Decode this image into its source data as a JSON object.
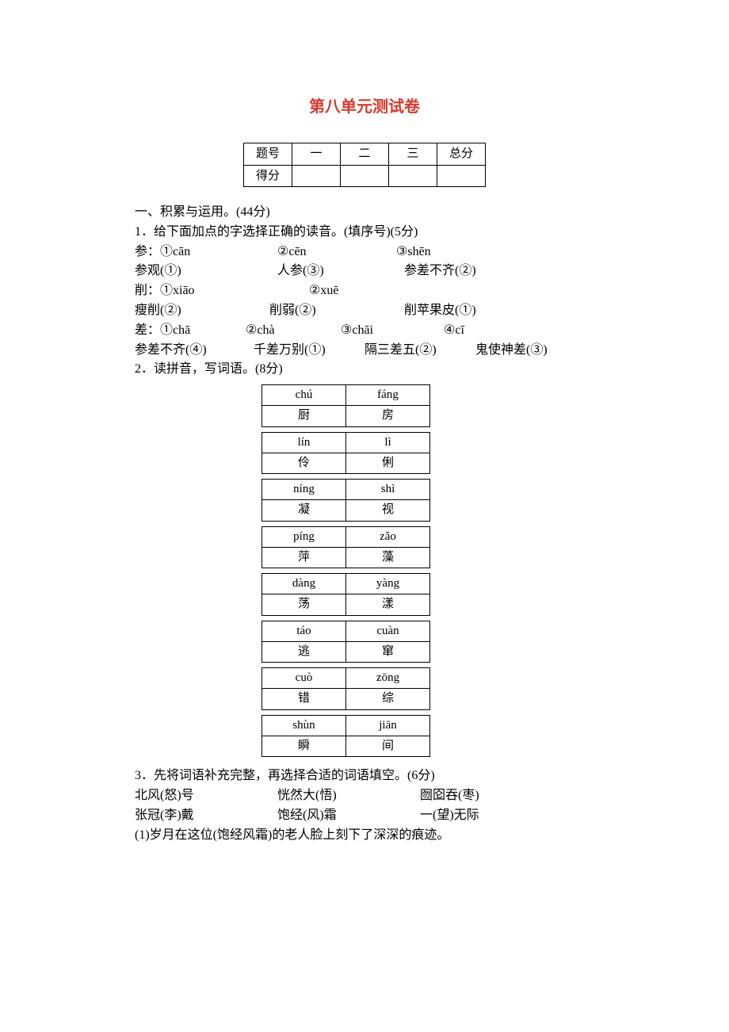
{
  "title": "第八单元测试卷",
  "scoreTable": {
    "headers": [
      "题号",
      "一",
      "二",
      "三",
      "总分"
    ],
    "row2label": "得分"
  },
  "section1": {
    "heading": "一、积累与运用。(44分)",
    "q1": {
      "prompt": "1．给下面加点的字选择正确的读音。(填序号)(5分)",
      "lines": [
        [
          "参：①cān",
          "②cēn",
          "③shēn"
        ],
        [
          "参观(①)",
          "人参(③)",
          "参差不齐(②)"
        ],
        [
          "削：①xiāo",
          "②xuē"
        ],
        [
          "瘦削(②)",
          "削弱(②)",
          "削苹果皮(①)"
        ],
        [
          "差：①chā",
          "②chà",
          "③chāi",
          "④cī"
        ],
        [
          "参差不齐(④)",
          "千差万别(①)",
          "隔三差五(②)",
          "鬼使神差(③)"
        ]
      ]
    },
    "q2": {
      "prompt": "2．读拼音，写词语。(8分)",
      "pairs": [
        {
          "py": [
            "chú",
            "fáng"
          ],
          "zi": [
            "厨",
            "房"
          ]
        },
        {
          "py": [
            "lín",
            "lì"
          ],
          "zi": [
            "伶",
            "俐"
          ]
        },
        {
          "py": [
            "níng",
            "shì"
          ],
          "zi": [
            "凝",
            "视"
          ]
        },
        {
          "py": [
            "píng",
            "zǎo"
          ],
          "zi": [
            "萍",
            "藻"
          ]
        },
        {
          "py": [
            "dàng",
            "yàng"
          ],
          "zi": [
            "荡",
            "漾"
          ]
        },
        {
          "py": [
            "táo",
            "cuàn"
          ],
          "zi": [
            "逃",
            "窜"
          ]
        },
        {
          "py": [
            "cuò",
            "zōng"
          ],
          "zi": [
            "错",
            "综"
          ]
        },
        {
          "py": [
            "shùn",
            "jiān"
          ],
          "zi": [
            "瞬",
            "间"
          ]
        }
      ]
    },
    "q3": {
      "prompt": "3．先将词语补充完整，再选择合适的词语填空。(6分)",
      "row1": [
        "北风(怒)号",
        "恍然大(悟)",
        "囫囵吞(枣)"
      ],
      "row2": [
        "张冠(李)戴",
        "饱经(风)霜",
        "一(望)无际"
      ],
      "sub1": "(1)岁月在这位(饱经风霜)的老人脸上刻下了深深的痕迹。"
    }
  }
}
